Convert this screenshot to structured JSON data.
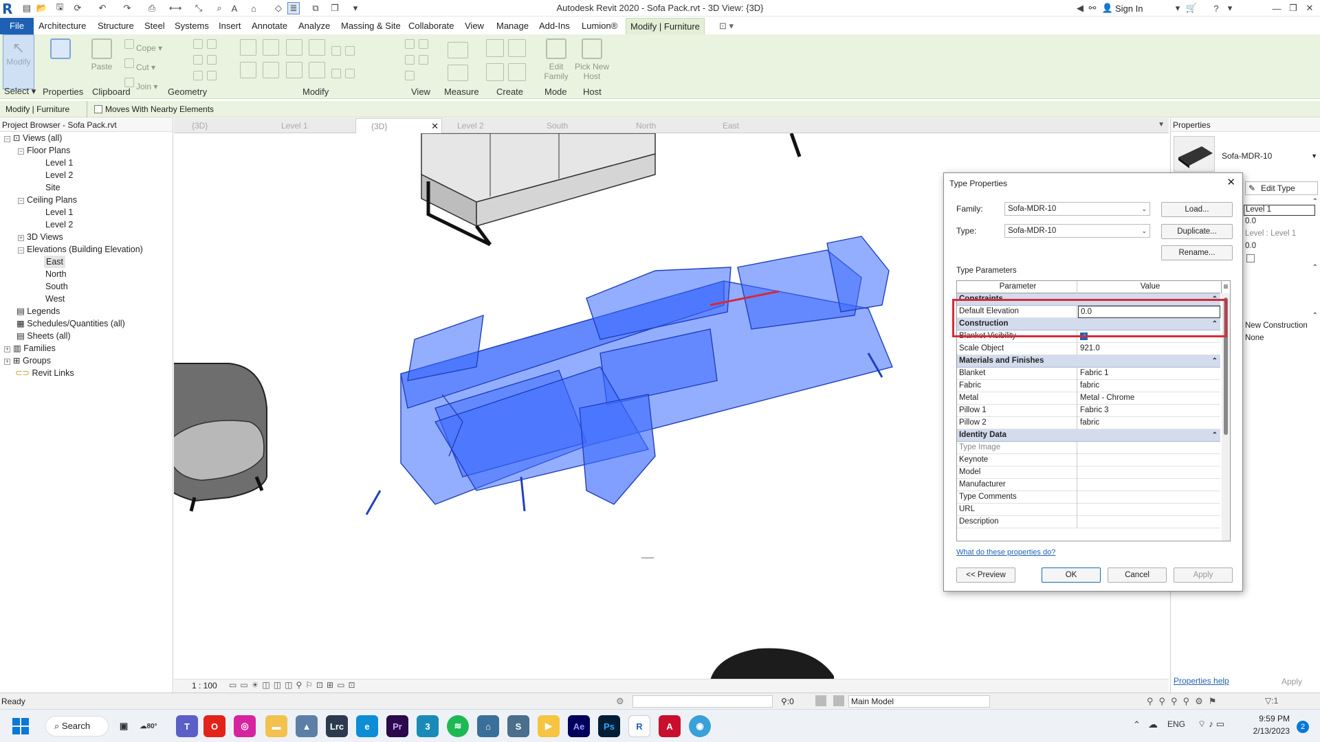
{
  "window": {
    "title": "Autodesk Revit 2020 - Sofa Pack.rvt - 3D View: {3D}",
    "sign_in": "Sign In"
  },
  "menu_tabs": [
    "File",
    "Architecture",
    "Structure",
    "Steel",
    "Systems",
    "Insert",
    "Annotate",
    "Analyze",
    "Massing & Site",
    "Collaborate",
    "View",
    "Manage",
    "Add-Ins",
    "Lumion®",
    "Modify | Furniture"
  ],
  "ribbon": {
    "buttons": {
      "modify": "Modify",
      "properties": "Properties",
      "paste": "Paste",
      "cope": "Cope",
      "cut": "Cut",
      "join": "Join",
      "edit_family": "Edit Family",
      "pick_new_host": "Pick New Host"
    },
    "groups": {
      "select": "Select ▾",
      "properties": "Properties",
      "clipboard": "Clipboard",
      "geometry": "Geometry",
      "modify": "Modify",
      "view": "View",
      "measure": "Measure",
      "create": "Create",
      "mode": "Mode",
      "host": "Host"
    }
  },
  "options_bar": {
    "context": "Modify | Furniture",
    "moves_with": "Moves With Nearby Elements"
  },
  "project_browser": {
    "title": "Project Browser - Sofa Pack.rvt",
    "items": [
      "Views (all)",
      "Floor Plans",
      "Level 1",
      "Level 2",
      "Site",
      "Ceiling Plans",
      "Level 1",
      "Level 2",
      "3D Views",
      "Elevations (Building Elevation)",
      "East",
      "North",
      "South",
      "West",
      "Legends",
      "Schedules/Quantities (all)",
      "Sheets (all)",
      "Families",
      "Groups",
      "Revit Links"
    ]
  },
  "view_tabs": [
    "{3D}",
    "Level 1",
    "{3D}",
    "Level 2",
    "South",
    "North",
    "East"
  ],
  "view_bar": {
    "scale": "1 : 100"
  },
  "properties_panel": {
    "title": "Properties",
    "type_name": "Sofa-MDR-10",
    "edit_type": "Edit Type",
    "values": [
      "Level 1",
      "0.0",
      "Level : Level 1",
      "0.0",
      "New Construction",
      "None"
    ],
    "help": "Properties help",
    "apply": "Apply"
  },
  "dialog": {
    "title": "Type Properties",
    "family_label": "Family:",
    "family_value": "Sofa-MDR-10",
    "type_label": "Type:",
    "type_value": "Sofa-MDR-10",
    "load": "Load...",
    "duplicate": "Duplicate...",
    "rename": "Rename...",
    "type_parameters": "Type Parameters",
    "col_parameter": "Parameter",
    "col_value": "Value",
    "rows": [
      {
        "section": "Constraints"
      },
      {
        "p": "Default Elevation",
        "v": "0.0"
      },
      {
        "section": "Construction"
      },
      {
        "p": "Blanket Visibility",
        "v": "",
        "check": true
      },
      {
        "p": "Scale Object",
        "v": "921.0"
      },
      {
        "section": "Materials and Finishes"
      },
      {
        "p": "Blanket",
        "v": "Fabric 1"
      },
      {
        "p": "Fabric",
        "v": "fabric"
      },
      {
        "p": "Metal",
        "v": "Metal - Chrome"
      },
      {
        "p": "Pillow 1",
        "v": "Fabric 3"
      },
      {
        "p": "Pillow 2",
        "v": "fabric"
      },
      {
        "section": "Identity Data"
      },
      {
        "p": "Type Image",
        "v": ""
      },
      {
        "p": "Keynote",
        "v": ""
      },
      {
        "p": "Model",
        "v": ""
      },
      {
        "p": "Manufacturer",
        "v": ""
      },
      {
        "p": "Type Comments",
        "v": ""
      },
      {
        "p": "URL",
        "v": ""
      },
      {
        "p": "Description",
        "v": ""
      }
    ],
    "help_link": "What do these properties do?",
    "preview": "<< Preview",
    "ok": "OK",
    "cancel": "Cancel",
    "apply": "Apply"
  },
  "status_bar": {
    "ready": "Ready",
    "zero": ":0",
    "model": "Main Model"
  },
  "taskbar": {
    "search": "Search",
    "weather": "80°",
    "lang": "ENG",
    "time": "9:59 PM",
    "date": "2/13/2023",
    "badge": "2"
  },
  "colors": {
    "accent": "#1e61b4",
    "ribbon_bg": "#e9f3df",
    "highlight": "#d72a3a",
    "selection_blue": "#3d6bff"
  }
}
